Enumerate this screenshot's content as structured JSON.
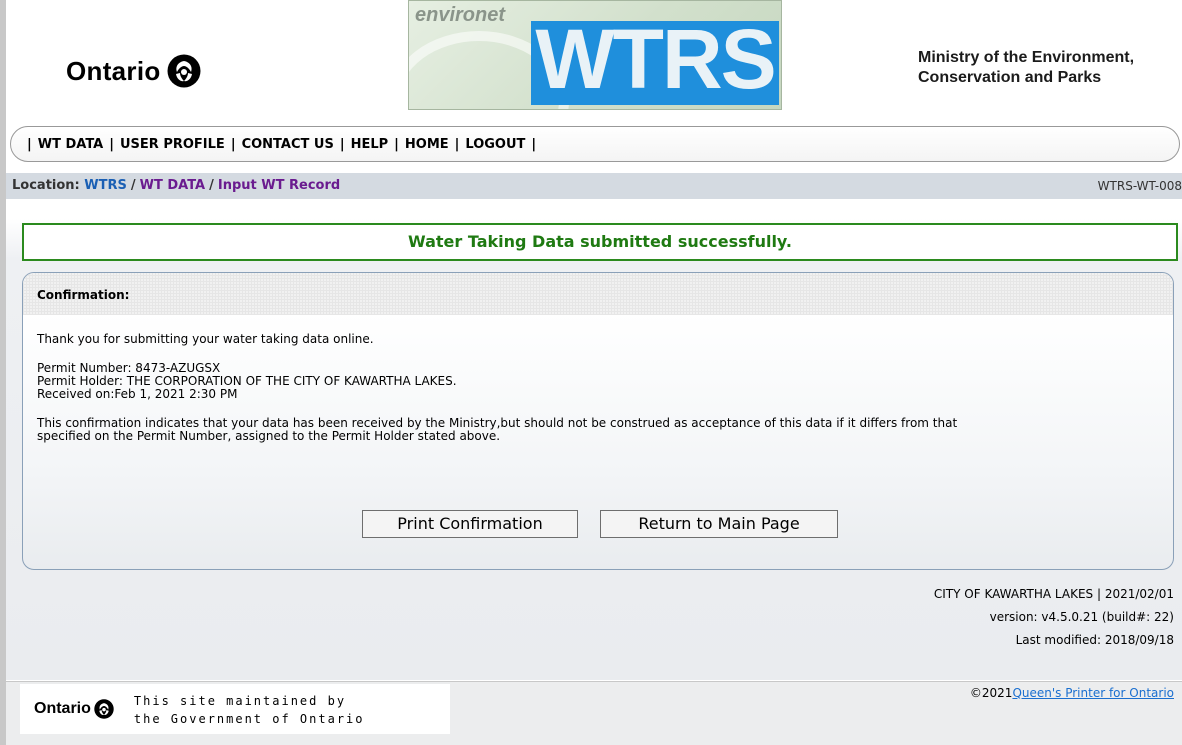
{
  "header": {
    "ontario_word": "Ontario",
    "banner": {
      "environet": "environet",
      "wtrs": "WTRS"
    },
    "ministry_line1": "Ministry of the Environment,",
    "ministry_line2": "Conservation and Parks"
  },
  "nav": {
    "separator": "|",
    "items": [
      "WT DATA",
      "USER PROFILE",
      "CONTACT US",
      "HELP",
      "HOME",
      "LOGOUT"
    ]
  },
  "location": {
    "label": "Location:",
    "crumbs": [
      "WTRS",
      "WT DATA",
      "Input WT Record"
    ],
    "separator": "/",
    "page_id": "WTRS-WT-008"
  },
  "success_message": "Water Taking Data submitted successfully.",
  "confirmation": {
    "title": "Confirmation:",
    "thanks": "Thank you for submitting your water taking data online.",
    "permit_number": "Permit Number: 8473-AZUGSX",
    "permit_holder": "Permit Holder: THE CORPORATION OF THE CITY OF KAWARTHA LAKES.",
    "received_on": "Received on:Feb 1, 2021 2:30 PM",
    "notice_line1": "This confirmation indicates that your data has been received by the Ministry,but should not be construed as acceptance of this data if it differs from that",
    "notice_line2": "specified on the Permit Number, assigned to the Permit Holder stated above.",
    "print_button": "Print Confirmation",
    "return_button": "Return to Main Page"
  },
  "meta": {
    "org_date": "CITY OF KAWARTHA LAKES | 2021/02/01",
    "version": "version: v4.5.0.21 (build#: 22)",
    "last_modified": "Last modified: 2018/09/18"
  },
  "footer": {
    "ontario_word": "Ontario",
    "maintained_line1": "This site maintained by",
    "maintained_line2": "the Government of Ontario",
    "copyright_prefix": "©2021",
    "copyright_link": "Queen's Printer for Ontario"
  },
  "colors": {
    "success_green": "#2b8a1e",
    "link_blue": "#1a5fb4",
    "link_purple": "#6a1b8f",
    "wtrs_blue": "#1f8fdc"
  },
  "icons": [
    "trillium-icon"
  ]
}
